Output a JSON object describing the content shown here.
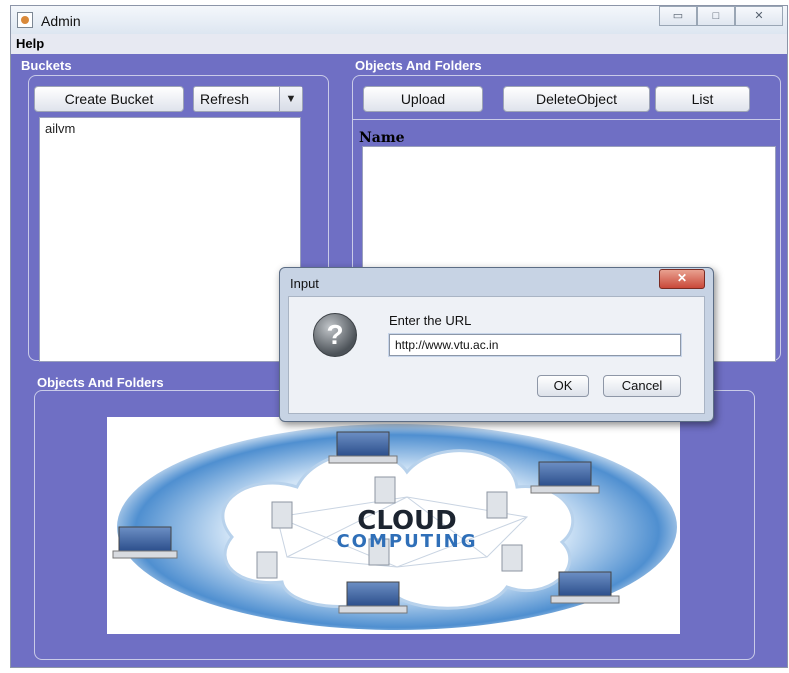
{
  "window": {
    "title": "Admin",
    "controls": {
      "minimize": "▭",
      "maximize": "□",
      "close": "✕"
    }
  },
  "menu": {
    "help": "Help"
  },
  "buckets": {
    "label": "Buckets",
    "create_button": "Create Bucket",
    "refresh_combo": "Refresh",
    "combo_arrow": "▼",
    "items": [
      "ailvm"
    ]
  },
  "objects_top": {
    "label": "Objects And Folders",
    "upload_button": "Upload",
    "delete_button": "DeleteObject",
    "list_button": "List",
    "column_header": "Name"
  },
  "objects_bottom": {
    "label": "Objects And Folders",
    "image_title_line1": "CLOUD",
    "image_title_line2": "COMPUTING"
  },
  "dialog": {
    "title": "Input",
    "close": "✕",
    "icon": "?",
    "prompt": "Enter the URL",
    "url_value": "http://www.vtu.ac.in",
    "ok_button": "OK",
    "cancel_button": "Cancel"
  },
  "colors": {
    "background": "#6f6fc4",
    "panel_text": "#ffffff",
    "cloud_blue": "#2f6fb8"
  }
}
